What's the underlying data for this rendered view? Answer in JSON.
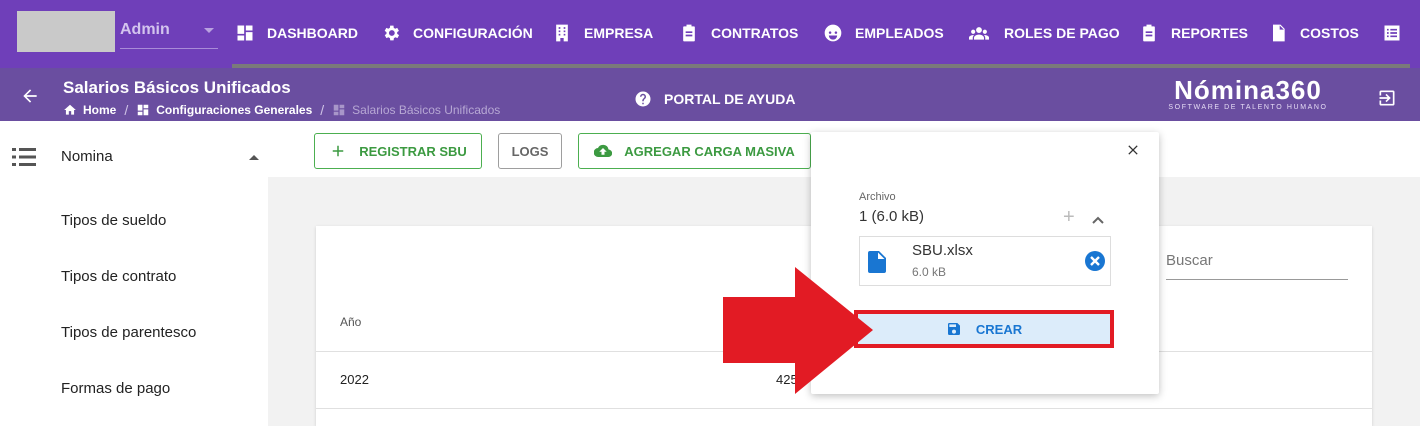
{
  "topnav": {
    "user": "Admin",
    "items": [
      {
        "label": "DASHBOARD",
        "icon": "dashboard-icon"
      },
      {
        "label": "CONFIGURACIÓN",
        "icon": "gear-icon"
      },
      {
        "label": "EMPRESA",
        "icon": "building-icon"
      },
      {
        "label": "CONTRATOS",
        "icon": "clipboard-icon"
      },
      {
        "label": "EMPLEADOS",
        "icon": "face-icon"
      },
      {
        "label": "ROLES DE PAGO",
        "icon": "people-icon"
      },
      {
        "label": "REPORTES",
        "icon": "clipboard-icon"
      },
      {
        "label": "COSTOS",
        "icon": "invoice-icon"
      }
    ]
  },
  "subheader": {
    "title": "Salarios Básicos Unificados",
    "breadcrumbs": [
      "Home",
      "Configuraciones Generales",
      "Salarios Básicos Unificados"
    ],
    "help_label": "PORTAL DE AYUDA",
    "logo_main": "Nómina360",
    "logo_sub": "SOFTWARE DE TALENTO HUMANO"
  },
  "sidebar": {
    "group": "Nomina",
    "items": [
      "Tipos de sueldo",
      "Tipos de contrato",
      "Tipos de parentesco",
      "Formas de pago"
    ]
  },
  "toolbar": {
    "register": "REGISTRAR SBU",
    "logs": "LOGS",
    "bulk": "AGREGAR CARGA MASIVA"
  },
  "table": {
    "search_placeholder": "Buscar",
    "column_year": "Año",
    "rows": [
      {
        "year": "2022",
        "value": "425"
      }
    ]
  },
  "upload": {
    "label": "Archivo",
    "count": "1 (6.0 kB)",
    "file_name": "SBU.xlsx",
    "file_size": "6.0 kB",
    "create_label": "CREAR"
  },
  "colors": {
    "primary": "#6f3fb9",
    "subheader": "#6a4ea0",
    "success": "#4caf50",
    "info": "#1976d2",
    "highlight": "#e21b24"
  }
}
